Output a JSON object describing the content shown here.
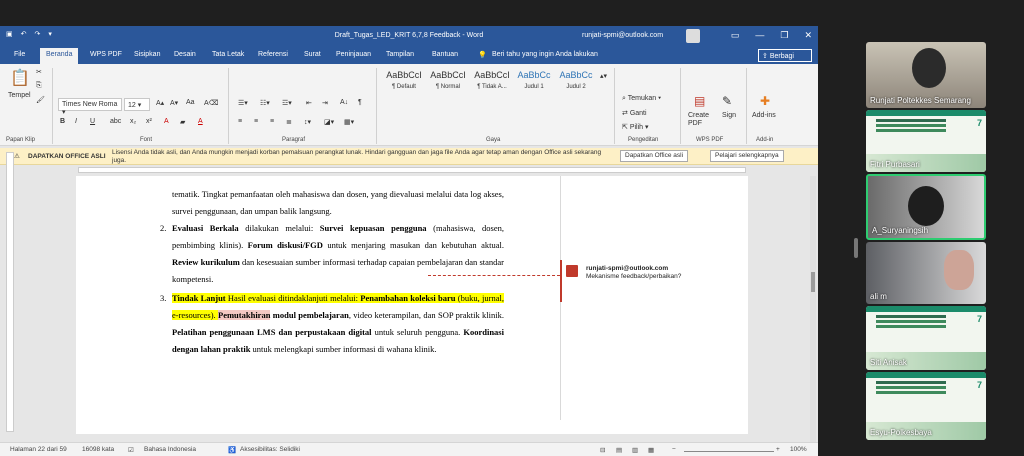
{
  "window": {
    "title": "Draft_Tugas_LED_KRIT 6,7,8 Feedback  -  Word",
    "user": "runjati-spmi@outlook.com",
    "min": "—",
    "max": "❐",
    "close": "✕"
  },
  "tabs": [
    "File",
    "Beranda",
    "WPS PDF",
    "Sisipkan",
    "Desain",
    "Tata Letak",
    "Referensi",
    "Surat",
    "Peninjauan",
    "Tampilan",
    "Bantuan"
  ],
  "tellme": "Beri tahu yang ingin Anda lakukan",
  "share": "Berbagi",
  "ribbon": {
    "paste": "Tempel",
    "font_name": "Times New Roma",
    "font_size": "12",
    "groups": [
      "Papan Klip",
      "Font",
      "Paragraf",
      "Gaya",
      "Pengeditan",
      "WPS PDF",
      "Add-in"
    ],
    "styles": [
      {
        "sample": "AaBbCcI",
        "name": "¶ Default"
      },
      {
        "sample": "AaBbCcI",
        "name": "¶ Normal"
      },
      {
        "sample": "AaBbCcI",
        "name": "¶ Tidak A..."
      },
      {
        "sample": "AaBbCc",
        "name": "Judul 1"
      },
      {
        "sample": "AaBbCc",
        "name": "Judul 2"
      }
    ],
    "find": "Temukan",
    "replace": "Ganti",
    "select": "Pilih",
    "create_pdf": "Create PDF",
    "sign": "Sign",
    "addins": "Add-ins"
  },
  "message": {
    "badge": "DAPATKAN OFFICE ASLI",
    "text": "Lisensi Anda tidak asli, dan Anda mungkin menjadi korban pemalsuan perangkat lunak. Hindari gangguan dan jaga file Anda agar tetap aman dengan Office asli sekarang juga.",
    "btn1": "Dapatkan Office asli",
    "btn2": "Pelajari selengkapnya"
  },
  "doc": {
    "line0": "tematik. Tingkat pemanfaatan oleh mahasiswa dan dosen, yang dievaluasi melalui data log akses, survei penggunaan, dan umpan balik langsung.",
    "item2_num": "2.",
    "item2_a": "Evaluasi Berkala",
    "item2_b": " dilakukan melalui: ",
    "item2_c": "Survei kepuasan pengguna",
    "item2_d": " (mahasiswa, dosen, pembimbing klinis). ",
    "item2_e": "Forum diskusi/FGD",
    "item2_f": " untuk menjaring masukan dan kebutuhan aktual. ",
    "item2_g": "Review kurikulum",
    "item2_h": " dan kesesuaian sumber informasi terhadap capaian pembelajaran dan standar kompetensi.",
    "item3_num": "3.",
    "item3_a": "Tindak Lanjut",
    "item3_b": " Hasil evaluasi ditindaklanjuti melalui: ",
    "item3_c": "Penambahan koleksi baru",
    "item3_d": " (buku, jurnal, e-resources). ",
    "item3_e": "Pemutakhiran",
    "item3_f": " modul pembelajaran",
    "item3_g": ", video keterampilan, dan SOP praktik klinik. ",
    "item3_h": "Pelatihan penggunaan LMS dan perpustakaan digital",
    "item3_i": " untuk seluruh pengguna. ",
    "item3_j": "Koordinasi dengan lahan praktik",
    "item3_k": " untuk melengkapi sumber informasi di wahana klinik."
  },
  "comment": {
    "author": "runjati-spmi@outlook.com",
    "text": "Mekanisme feedback/perbaikan?"
  },
  "status": {
    "page": "Halaman 22 dari 59",
    "words": "16098 kata",
    "lang": "Bahasa Indonesia",
    "access": "Aksesibilitas: Selidiki",
    "zoom": "100%"
  },
  "participants": [
    {
      "name": "Runjati Poltekkes Semarang",
      "kind": "camera"
    },
    {
      "name": "Fitri Purbasari",
      "kind": "slide",
      "slide_num": "7"
    },
    {
      "name": "A_Suryaningsih",
      "kind": "camera"
    },
    {
      "name": "ali m",
      "kind": "camera"
    },
    {
      "name": "Siti Anisak",
      "kind": "slide",
      "slide_num": "7"
    },
    {
      "name": "Esyu-Polkesbaya",
      "kind": "slide",
      "slide_num": "7"
    }
  ],
  "colors": {
    "word_blue": "#2b579a",
    "highlight": "#ffff00",
    "comment_red": "#c0392b",
    "active_speaker": "#2ecc71"
  }
}
